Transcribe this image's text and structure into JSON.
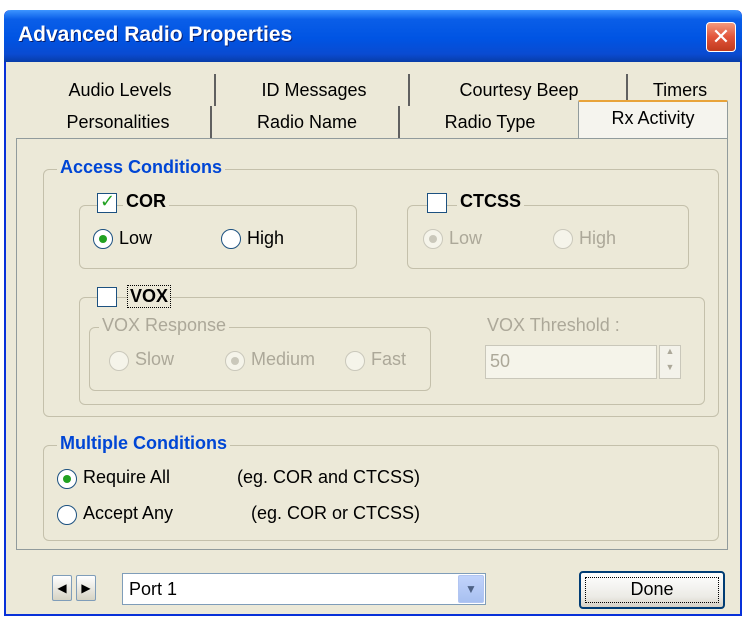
{
  "window": {
    "title": "Advanced Radio Properties"
  },
  "tabs": {
    "row1": [
      "Audio Levels",
      "ID Messages",
      "Courtesy Beep",
      "Timers"
    ],
    "row2": [
      "Personalities",
      "Radio Name",
      "Radio Type",
      "Rx Activity"
    ],
    "active": "Rx Activity"
  },
  "access": {
    "legend": "Access Conditions",
    "cor": {
      "label": "COR",
      "checked": true,
      "low": "Low",
      "high": "High",
      "selected": "Low"
    },
    "ctcss": {
      "label": "CTCSS",
      "checked": false,
      "low": "Low",
      "high": "High",
      "selected": "Low"
    },
    "vox": {
      "label": "VOX",
      "checked": false,
      "response_legend": "VOX Response",
      "slow": "Slow",
      "medium": "Medium",
      "fast": "Fast",
      "selected": "Medium",
      "threshold_label": "VOX Threshold :",
      "threshold_value": "50"
    }
  },
  "multiple": {
    "legend": "Multiple Conditions",
    "require_all": "Require All",
    "require_all_hint": "(eg. COR and CTCSS)",
    "accept_any": "Accept Any",
    "accept_any_hint": "(eg. COR or CTCSS)",
    "selected": "Require All"
  },
  "footer": {
    "port": "Port 1",
    "done": "Done"
  },
  "colors": {
    "title_bar": "#0054e3",
    "accent_legend": "#0046d5",
    "dialog_bg": "#ece9d8"
  },
  "icons": {
    "close": "close-icon",
    "prev": "arrow-left-icon",
    "next": "arrow-right-icon",
    "dropdown": "chevron-down-icon"
  }
}
